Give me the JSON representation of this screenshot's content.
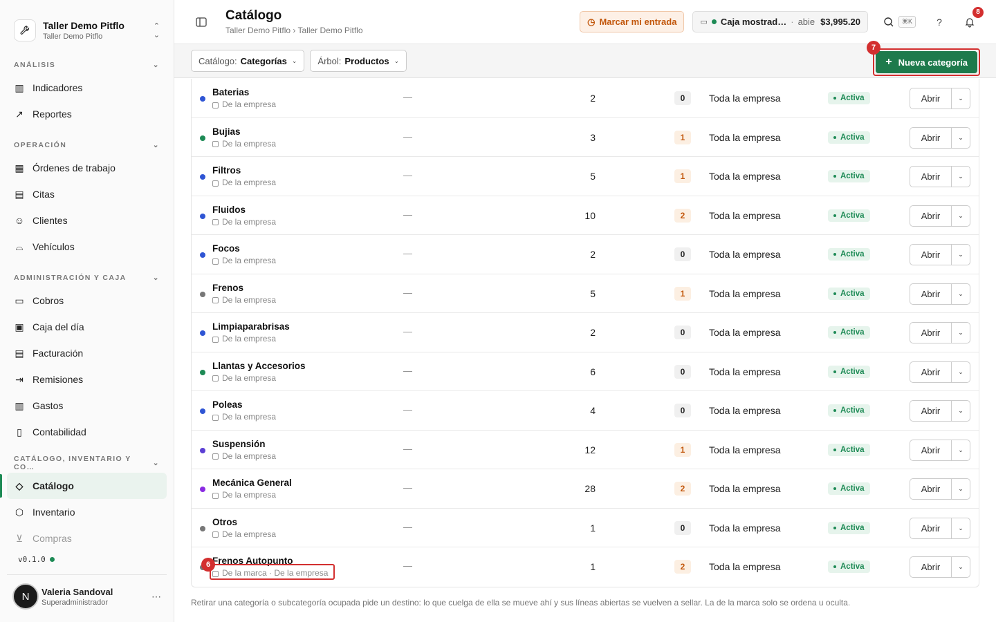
{
  "workspace": {
    "name": "Taller Demo Pitflo",
    "sub": "Taller Demo Pitflo"
  },
  "sidebar": {
    "sections": [
      {
        "label": "ANÁLISIS",
        "items": [
          {
            "label": "Indicadores",
            "icon": "bar-chart-icon"
          },
          {
            "label": "Reportes",
            "icon": "trend-icon"
          }
        ]
      },
      {
        "label": "OPERACIÓN",
        "items": [
          {
            "label": "Órdenes de trabajo",
            "icon": "kanban-icon"
          },
          {
            "label": "Citas",
            "icon": "calendar-icon"
          },
          {
            "label": "Clientes",
            "icon": "users-icon"
          },
          {
            "label": "Vehículos",
            "icon": "car-icon"
          }
        ]
      },
      {
        "label": "ADMINISTRACIÓN Y CAJA",
        "items": [
          {
            "label": "Cobros",
            "icon": "card-icon"
          },
          {
            "label": "Caja del día",
            "icon": "cash-icon"
          },
          {
            "label": "Facturación",
            "icon": "invoice-icon"
          },
          {
            "label": "Remisiones",
            "icon": "file-export-icon"
          },
          {
            "label": "Gastos",
            "icon": "receipt-icon"
          },
          {
            "label": "Contabilidad",
            "icon": "book-icon"
          }
        ]
      },
      {
        "label": "CATÁLOGO, INVENTARIO Y CO…",
        "items": [
          {
            "label": "Catálogo",
            "icon": "tag-icon",
            "active": true
          },
          {
            "label": "Inventario",
            "icon": "box-icon"
          },
          {
            "label": "Compras",
            "icon": "cart-icon"
          }
        ]
      }
    ],
    "version": "v0.1.0",
    "user": {
      "initial": "N",
      "name": "Valeria Sandoval",
      "role": "Superadministrador"
    }
  },
  "header": {
    "title": "Catálogo",
    "breadcrumb": "Taller Demo Pitflo › Taller Demo Pitflo",
    "checkin_label": "Marcar mi entrada",
    "cash": {
      "name": "Caja mostrad…",
      "status": "abie",
      "amount": "$3,995.20"
    },
    "search_shortcut": "⌘K",
    "notifications": "8"
  },
  "filters": {
    "catalog_label": "Catálogo:",
    "catalog_value": "Categorías",
    "tree_label": "Árbol:",
    "tree_value": "Productos",
    "new_button": "Nueva categoría"
  },
  "markers": {
    "new_button": "7",
    "scope": "6"
  },
  "rows": [
    {
      "name": "Baterias",
      "scope": "De la empresa",
      "dash": "—",
      "count": "2",
      "sub": "0",
      "reach": "Toda la empresa",
      "status": "Activa",
      "color": "#2f55d4"
    },
    {
      "name": "Bujias",
      "scope": "De la empresa",
      "dash": "—",
      "count": "3",
      "sub": "1",
      "reach": "Toda la empresa",
      "status": "Activa",
      "color": "#1d8a55"
    },
    {
      "name": "Filtros",
      "scope": "De la empresa",
      "dash": "—",
      "count": "5",
      "sub": "1",
      "reach": "Toda la empresa",
      "status": "Activa",
      "color": "#2f55d4"
    },
    {
      "name": "Fluidos",
      "scope": "De la empresa",
      "dash": "—",
      "count": "10",
      "sub": "2",
      "reach": "Toda la empresa",
      "status": "Activa",
      "color": "#2f55d4"
    },
    {
      "name": "Focos",
      "scope": "De la empresa",
      "dash": "—",
      "count": "2",
      "sub": "0",
      "reach": "Toda la empresa",
      "status": "Activa",
      "color": "#2f55d4"
    },
    {
      "name": "Frenos",
      "scope": "De la empresa",
      "dash": "—",
      "count": "5",
      "sub": "1",
      "reach": "Toda la empresa",
      "status": "Activa",
      "color": "#777777"
    },
    {
      "name": "Limpiaparabrisas",
      "scope": "De la empresa",
      "dash": "—",
      "count": "2",
      "sub": "0",
      "reach": "Toda la empresa",
      "status": "Activa",
      "color": "#2f55d4"
    },
    {
      "name": "Llantas y Accesorios",
      "scope": "De la empresa",
      "dash": "—",
      "count": "6",
      "sub": "0",
      "reach": "Toda la empresa",
      "status": "Activa",
      "color": "#1d8a55"
    },
    {
      "name": "Poleas",
      "scope": "De la empresa",
      "dash": "—",
      "count": "4",
      "sub": "0",
      "reach": "Toda la empresa",
      "status": "Activa",
      "color": "#2f55d4"
    },
    {
      "name": "Suspensión",
      "scope": "De la empresa",
      "dash": "—",
      "count": "12",
      "sub": "1",
      "reach": "Toda la empresa",
      "status": "Activa",
      "color": "#5b3fd4"
    },
    {
      "name": "Mecánica General",
      "scope": "De la empresa",
      "dash": "—",
      "count": "28",
      "sub": "2",
      "reach": "Toda la empresa",
      "status": "Activa",
      "color": "#8a2be2"
    },
    {
      "name": "Otros",
      "scope": "De la empresa",
      "dash": "—",
      "count": "1",
      "sub": "0",
      "reach": "Toda la empresa",
      "status": "Activa",
      "color": "#777777"
    },
    {
      "name": "Frenos Autopunto",
      "scope": "De la marca · De la empresa",
      "dash": "—",
      "count": "1",
      "sub": "2",
      "reach": "Toda la empresa",
      "status": "Activa",
      "color": "#777777"
    }
  ],
  "row_action": "Abrir",
  "footnote": "Retirar una categoría o subcategoría ocupada pide un destino: lo que cuelga de ella se mueve ahí y sus líneas abiertas se vuelven a sellar. La de la marca solo se ordena u oculta."
}
